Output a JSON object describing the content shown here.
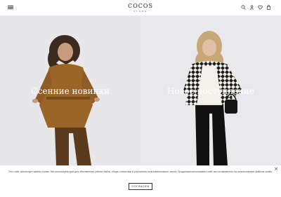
{
  "header": {
    "logo_main": "COCOS",
    "logo_sub": "STORE",
    "icons": [
      "menu-icon",
      "search-icon",
      "account-icon",
      "wishlist-icon",
      "cart-icon"
    ]
  },
  "hero": [
    {
      "title": "Осенние новинки"
    },
    {
      "title": "Новое поступление"
    }
  ],
  "cookie": {
    "text": "Этот сайт использует файлы cookie. Мы используем куки для обеспечения работы сайта, сбора статистики и улучшения пользовательского опыта. Продолжая использовать сайт, вы соглашаетесь на использование файлов cookie.",
    "button_label": "СОГЛАСЕН",
    "close_label": "×"
  }
}
